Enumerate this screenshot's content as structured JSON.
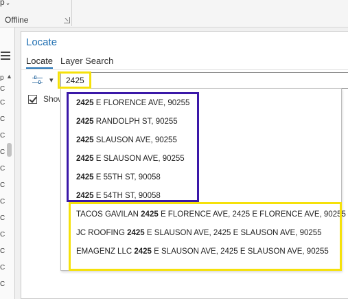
{
  "ribbon": {
    "fragment_label": "p",
    "offline_label": "Offline"
  },
  "left_strip": {
    "row_chars": [
      "p",
      "C",
      "C",
      "C",
      "C",
      "C",
      "C",
      "C",
      "C",
      "C",
      "C",
      "C",
      "C",
      "C"
    ]
  },
  "pane": {
    "title": "Locate",
    "tabs": [
      {
        "label": "Locate",
        "active": true
      },
      {
        "label": "Layer Search",
        "active": false
      }
    ],
    "search_value": "2425",
    "show_label": "Show"
  },
  "suggestions": {
    "address_results": [
      {
        "match": "2425",
        "rest": " E FLORENCE AVE, 90255"
      },
      {
        "match": "2425",
        "rest": " RANDOLPH ST, 90255"
      },
      {
        "match": "2425",
        "rest": " SLAUSON AVE, 90255"
      },
      {
        "match": "2425",
        "rest": " E SLAUSON AVE, 90255"
      },
      {
        "match": "2425",
        "rest": " E 55TH ST, 90058"
      },
      {
        "match": "2425",
        "rest": " E 54TH ST, 90058"
      }
    ],
    "poi_results": [
      {
        "prefix": "TACOS GAVILAN ",
        "match": "2425",
        "rest": " E FLORENCE AVE, 2425 E FLORENCE AVE, 90255"
      },
      {
        "prefix": "JC ROOFING ",
        "match": "2425",
        "rest": " E SLAUSON AVE, 2425 E SLAUSON AVE, 90255"
      },
      {
        "prefix": "EMAGENZ LLC ",
        "match": "2425",
        "rest": " E SLAUSON AVE, 2425 E SLAUSON AVE, 90255"
      }
    ]
  },
  "colors": {
    "accent": "#1f6fb2",
    "highlight_yellow": "#f5e10a",
    "highlight_purple": "#3a18a8"
  }
}
